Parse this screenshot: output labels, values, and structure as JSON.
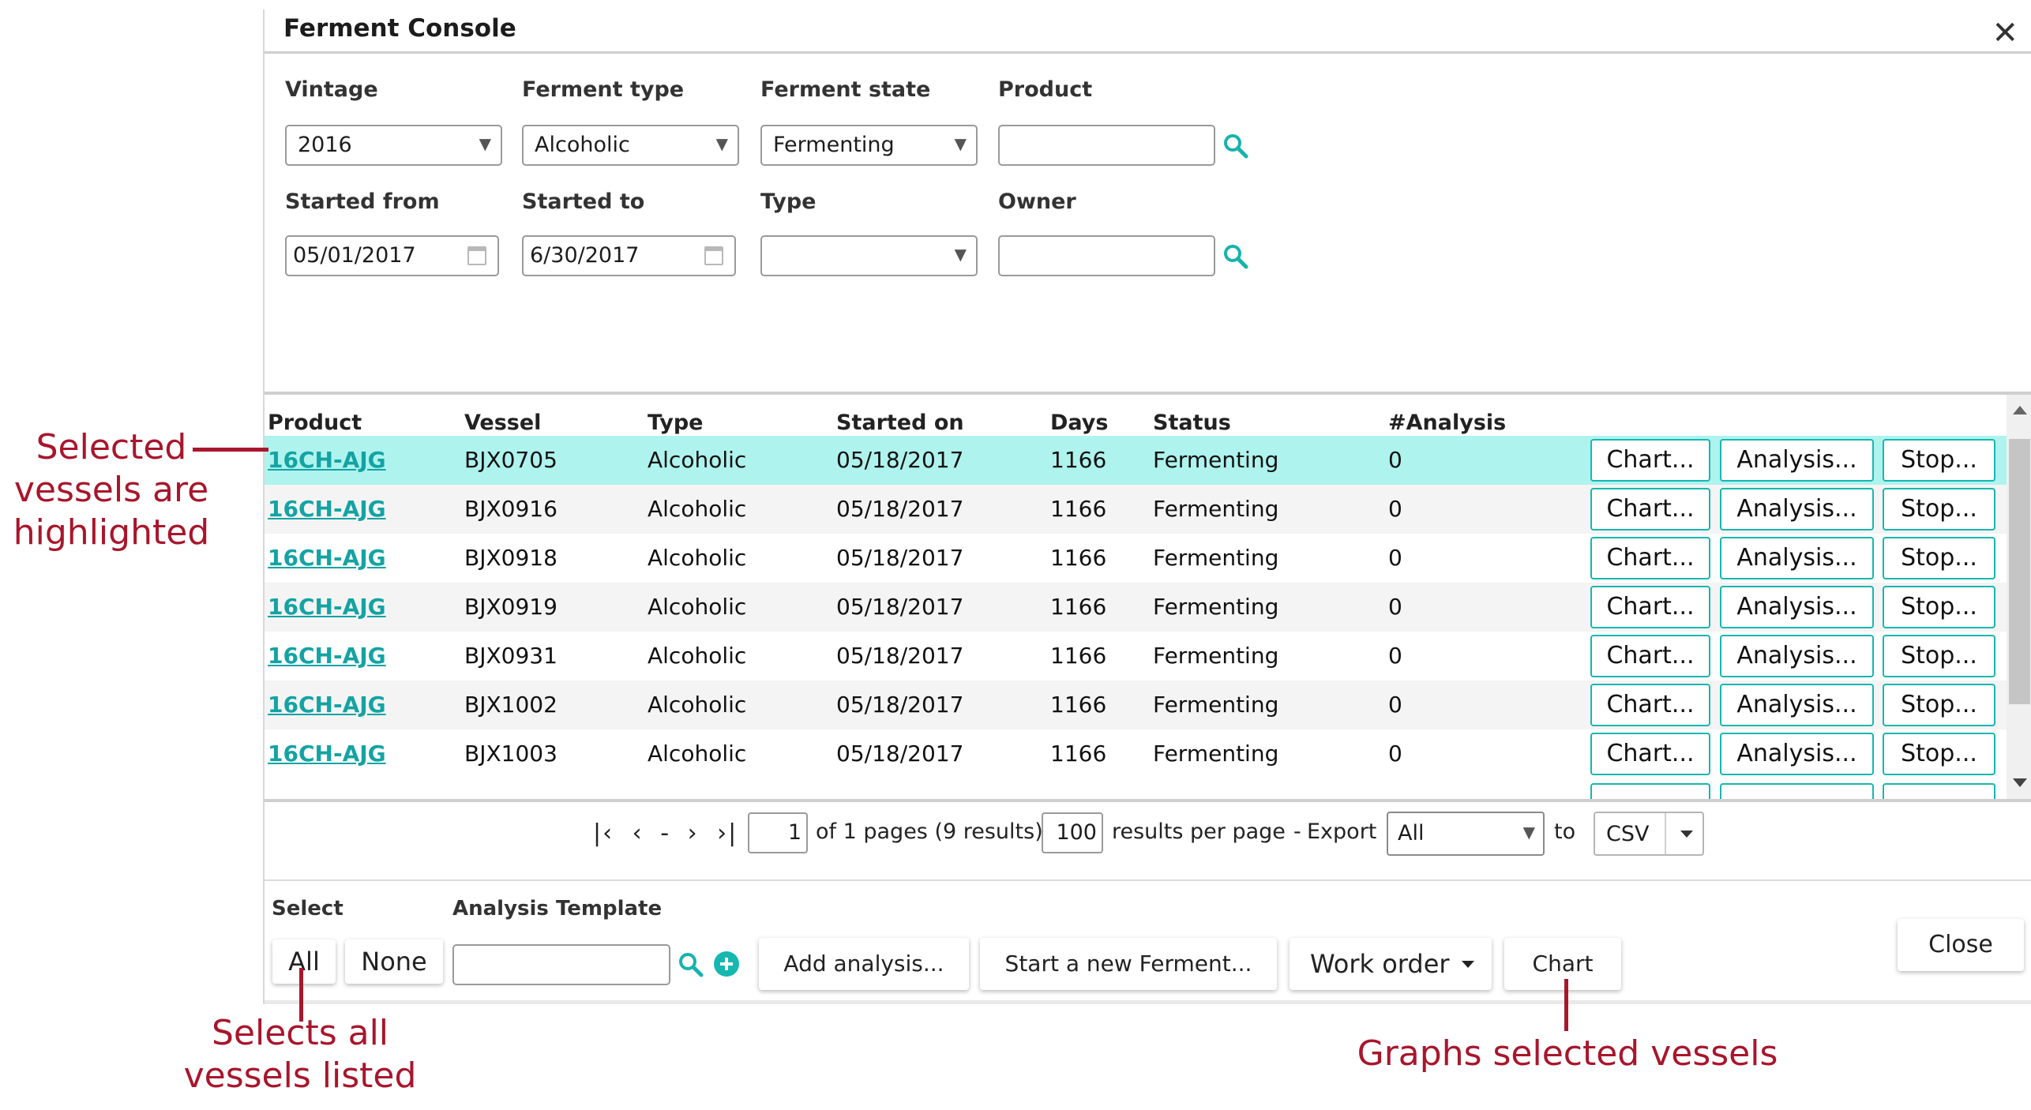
{
  "window": {
    "title": "Ferment Console"
  },
  "filters": {
    "vintage": {
      "label": "Vintage",
      "value": "2016"
    },
    "ferment_type": {
      "label": "Ferment type",
      "value": "Alcoholic"
    },
    "ferment_state": {
      "label": "Ferment state",
      "value": "Fermenting"
    },
    "product": {
      "label": "Product",
      "value": ""
    },
    "started_from": {
      "label": "Started from",
      "value": "05/01/2017"
    },
    "started_to": {
      "label": "Started to",
      "value": "6/30/2017"
    },
    "type": {
      "label": "Type",
      "value": ""
    },
    "owner": {
      "label": "Owner",
      "value": ""
    }
  },
  "grid": {
    "columns": [
      "Product",
      "Vessel",
      "Type",
      "Started on",
      "Days",
      "Status",
      "#Analysis"
    ],
    "row_buttons": [
      "Chart...",
      "Analysis...",
      "Stop..."
    ],
    "rows": [
      {
        "product": "16CH-AJG",
        "vessel": "BJX0705",
        "type": "Alcoholic",
        "started_on": "05/18/2017",
        "days": "1166",
        "status": "Fermenting",
        "analysis": "0",
        "selected": true
      },
      {
        "product": "16CH-AJG",
        "vessel": "BJX0916",
        "type": "Alcoholic",
        "started_on": "05/18/2017",
        "days": "1166",
        "status": "Fermenting",
        "analysis": "0",
        "selected": false
      },
      {
        "product": "16CH-AJG",
        "vessel": "BJX0918",
        "type": "Alcoholic",
        "started_on": "05/18/2017",
        "days": "1166",
        "status": "Fermenting",
        "analysis": "0",
        "selected": false
      },
      {
        "product": "16CH-AJG",
        "vessel": "BJX0919",
        "type": "Alcoholic",
        "started_on": "05/18/2017",
        "days": "1166",
        "status": "Fermenting",
        "analysis": "0",
        "selected": false
      },
      {
        "product": "16CH-AJG",
        "vessel": "BJX0931",
        "type": "Alcoholic",
        "started_on": "05/18/2017",
        "days": "1166",
        "status": "Fermenting",
        "analysis": "0",
        "selected": false
      },
      {
        "product": "16CH-AJG",
        "vessel": "BJX1002",
        "type": "Alcoholic",
        "started_on": "05/18/2017",
        "days": "1166",
        "status": "Fermenting",
        "analysis": "0",
        "selected": false
      },
      {
        "product": "16CH-AJG",
        "vessel": "BJX1003",
        "type": "Alcoholic",
        "started_on": "05/18/2017",
        "days": "1166",
        "status": "Fermenting",
        "analysis": "0",
        "selected": false
      }
    ]
  },
  "pager": {
    "page": "1",
    "pages_text": "of 1 pages (9 results).",
    "per_page": "100",
    "per_page_text": "results per page",
    "export_label": "Export",
    "export_scope": "All",
    "to_label": "to",
    "export_format": "CSV"
  },
  "toolbar": {
    "select_label": "Select",
    "template_label": "Analysis Template",
    "all": "All",
    "none": "None",
    "template_value": "",
    "add_analysis": "Add analysis...",
    "start_ferment": "Start a new Ferment...",
    "work_order": "Work order",
    "chart": "Chart",
    "close": "Close"
  },
  "annotations": {
    "selected_highlight": [
      "Selected",
      "vessels are",
      "highlighted"
    ],
    "select_all": [
      "Selects all",
      "vessels listed"
    ],
    "graphs": "Graphs selected vessels"
  },
  "colors": {
    "accent": "#16b7b0",
    "selected_row": "#aef3ee",
    "annotation": "#a8162c",
    "link": "#14a3a3"
  }
}
